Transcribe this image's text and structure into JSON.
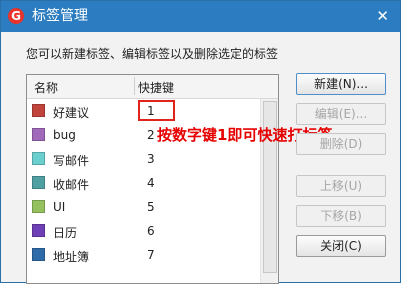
{
  "window": {
    "title": "标签管理",
    "app_icon_letter": "G",
    "close_glyph": "✕"
  },
  "description": "您可以新建标签、编辑标签以及删除选定的标签",
  "list": {
    "headers": {
      "name": "名称",
      "shortcut": "快捷键"
    },
    "rows": [
      {
        "name": "好建议",
        "key": "1",
        "color": "#c0443c"
      },
      {
        "name": "bug",
        "key": "2",
        "color": "#a169b9"
      },
      {
        "name": "写邮件",
        "key": "3",
        "color": "#6ccfcf"
      },
      {
        "name": "收邮件",
        "key": "4",
        "color": "#4f9fa3"
      },
      {
        "name": "UI",
        "key": "5",
        "color": "#94c15e"
      },
      {
        "name": "日历",
        "key": "6",
        "color": "#6f3fb5"
      },
      {
        "name": "地址簿",
        "key": "7",
        "color": "#2f6aa9"
      }
    ]
  },
  "annotation": "按数字键1即可快速打标签",
  "buttons": {
    "new": "新建(N)...",
    "edit": "编辑(E)...",
    "delete": "删除(D)",
    "move_up": "上移(U)",
    "move_down": "下移(B)",
    "close": "关闭(C)"
  }
}
